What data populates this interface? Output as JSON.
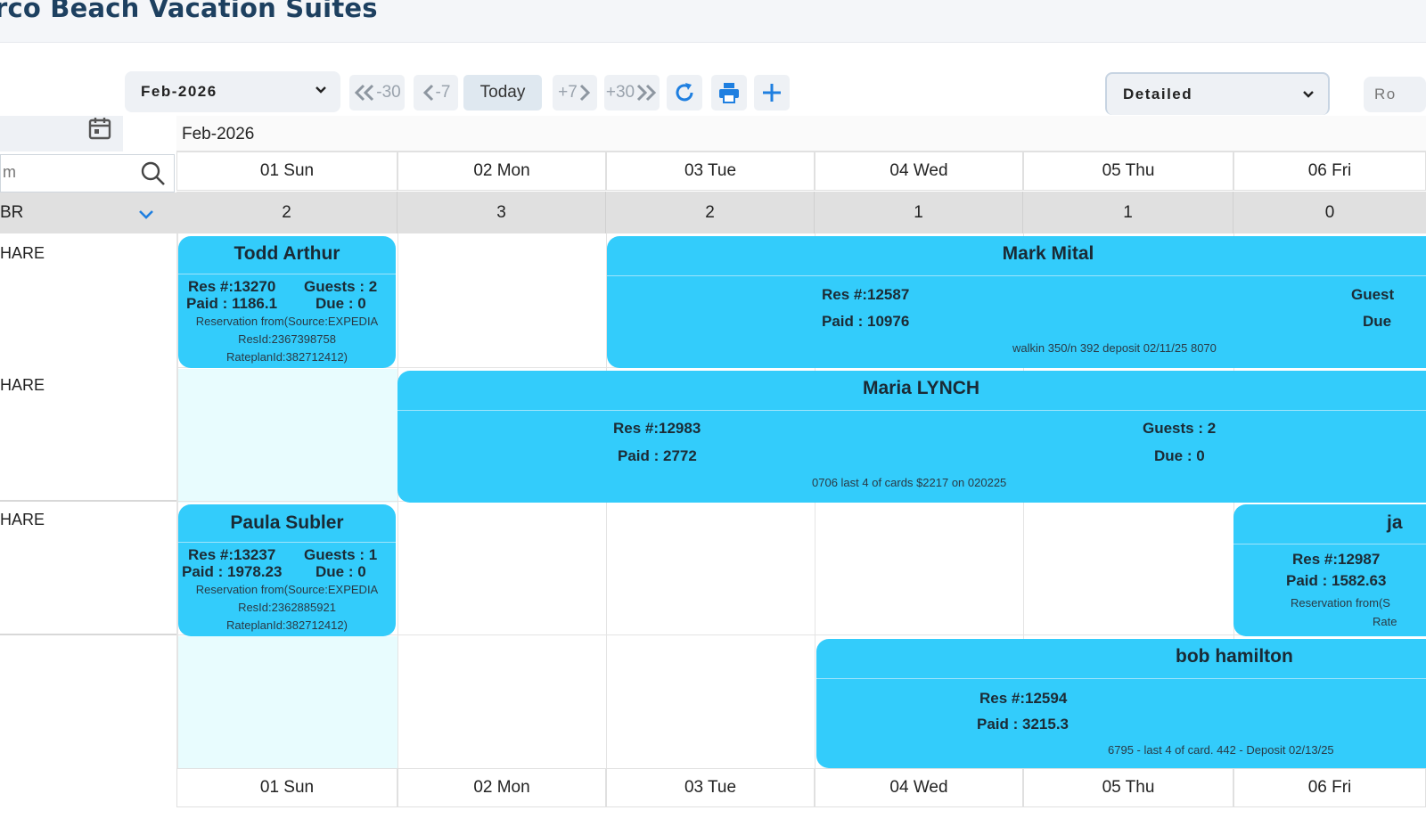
{
  "app": {
    "title": "rco Beach Vacation Suites"
  },
  "toolbar": {
    "month_select": "Feb-2026",
    "back30": "-30",
    "back7": "-7",
    "today": "Today",
    "fwd7": "+7",
    "fwd30": "+30",
    "view_select": "Detailed",
    "right_cut": "Ro"
  },
  "sidebar": {
    "search_placeholder": "m",
    "room_type": "BR",
    "rooms": [
      "HARE",
      "HARE",
      "HARE"
    ]
  },
  "calendar": {
    "month": "Feb-2026",
    "days": [
      "01 Sun",
      "02 Mon",
      "03 Tue",
      "04 Wed",
      "05 Thu",
      "06 Fri"
    ],
    "availability": [
      "2",
      "3",
      "2",
      "1",
      "1",
      "0"
    ]
  },
  "reservations": {
    "todd": {
      "name": "Todd Arthur",
      "res": "Res #:13270",
      "guests": "Guests : 2",
      "paid": "Paid : 1186.1",
      "due": "Due : 0",
      "note1": "Reservation from(Source:EXPEDIA",
      "note2": "ResId:2367398758",
      "note3": "RateplanId:382712412)"
    },
    "mark": {
      "name": "Mark Mital",
      "res": "Res #:12587",
      "paid": "Paid : 10976",
      "guests": "Guest",
      "due": "Due",
      "note": "walkin 350/n 392 deposit 02/11/25 8070"
    },
    "maria": {
      "name": "Maria LYNCH",
      "res": "Res #:12983",
      "paid": "Paid : 2772",
      "guests": "Guests : 2",
      "due": "Due : 0",
      "note": "0706 last 4 of cards $2217 on 020225"
    },
    "paula": {
      "name": "Paula Subler",
      "res": "Res #:13237",
      "guests": "Guests : 1",
      "paid": "Paid : 1978.23",
      "due": "Due : 0",
      "note1": "Reservation from(Source:EXPEDIA",
      "note2": "ResId:2362885921",
      "note3": "RateplanId:382712412)"
    },
    "ja": {
      "name": "ja",
      "res": "Res #:12987",
      "paid": "Paid : 1582.63",
      "note1": "Reservation from(S",
      "note2": "Rate"
    },
    "bob": {
      "name": "bob hamilton",
      "res": "Res #:12594",
      "paid": "Paid : 3215.3",
      "note": "6795 - last 4 of card. 442 - Deposit 02/13/25"
    }
  }
}
